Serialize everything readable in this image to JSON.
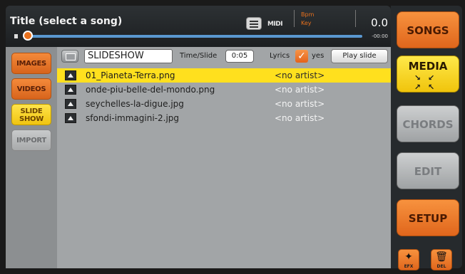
{
  "header": {
    "title": "Title (select a song)",
    "midi_label": "MIDI",
    "bpm_label": "Bpm",
    "key_label": "Key",
    "time_value": "0.0",
    "time_remaining": "-00:00",
    "progress": 0.0
  },
  "sidebar": {
    "items": [
      {
        "label": "IMAGES",
        "state": "normal"
      },
      {
        "label": "VIDEOS",
        "state": "normal"
      },
      {
        "label": "SLIDE\nSHOW",
        "state": "active"
      },
      {
        "label": "IMPORT",
        "state": "disabled"
      }
    ]
  },
  "toolbar": {
    "playlist_name": "SLIDESHOW",
    "time_slide_label": "Time/Slide",
    "time_slide_value": "0:05",
    "lyrics_label": "Lyrics",
    "lyrics_checked": true,
    "yes_label": "yes",
    "play_slide_label": "Play slide"
  },
  "files": [
    {
      "name": "01_Pianeta-Terra.png",
      "artist": "<no artist>",
      "selected": true
    },
    {
      "name": "onde-piu-belle-del-mondo.png",
      "artist": "<no artist>",
      "selected": false
    },
    {
      "name": "seychelles-la-digue.jpg",
      "artist": "<no artist>",
      "selected": false
    },
    {
      "name": "sfondi-immagini-2.jpg",
      "artist": "<no artist>",
      "selected": false
    }
  ],
  "right_menu": {
    "songs": "SONGS",
    "media": "MEDIA",
    "chords": "CHORDS",
    "edit": "EDIT",
    "setup": "SETUP",
    "efx": "EFX",
    "del": "DEL"
  },
  "colors": {
    "accent_orange": "#e8711d",
    "highlight_yellow": "#ffe01e",
    "progress_blue": "#5a98d0"
  }
}
